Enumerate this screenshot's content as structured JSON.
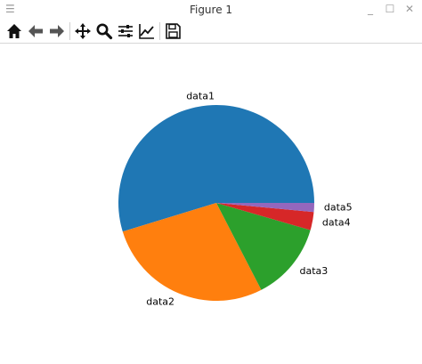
{
  "window": {
    "title": "Figure 1",
    "menu_icon": "hamburger-icon",
    "controls": [
      "minimize-icon",
      "maximize-icon",
      "close-icon"
    ]
  },
  "toolbar": {
    "buttons": [
      {
        "name": "home",
        "icon": "home-icon"
      },
      {
        "name": "back",
        "icon": "arrow-left-icon"
      },
      {
        "name": "forward",
        "icon": "arrow-right-icon"
      },
      {
        "name": "pan",
        "icon": "move-icon"
      },
      {
        "name": "zoom",
        "icon": "magnifier-icon"
      },
      {
        "name": "configure-subplots",
        "icon": "sliders-icon"
      },
      {
        "name": "edit-axis",
        "icon": "line-chart-icon"
      },
      {
        "name": "save",
        "icon": "floppy-disk-icon"
      }
    ]
  },
  "chart_data": {
    "type": "pie",
    "labels": [
      "data1",
      "data2",
      "data3",
      "data4",
      "data5"
    ],
    "values": [
      55,
      28,
      13,
      3,
      1.5
    ],
    "colors": [
      "#1f77b4",
      "#ff7f0e",
      "#2ca02c",
      "#d62728",
      "#9467bd"
    ],
    "start_angle": 0,
    "direction": "counterclockwise"
  }
}
